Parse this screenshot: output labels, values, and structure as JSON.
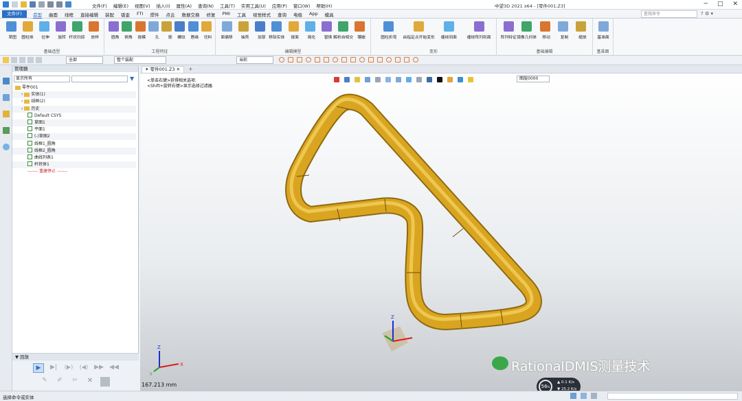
{
  "title_bar": {
    "menus": [
      "文件(F)",
      "编辑(E)",
      "视图(V)",
      "插入(I)",
      "属性(A)",
      "查询(N)",
      "工具(T)",
      "实用工具(U)",
      "应用(P)",
      "窗口(W)",
      "帮助(H)"
    ],
    "window_title": "中望3D 2021 x64 - [零件001.Z3]"
  },
  "tabs": {
    "file_label": "文件(F)",
    "items": [
      "造型",
      "曲面",
      "线框",
      "直接编辑",
      "装配",
      "钣金",
      "FTI",
      "焊件",
      "点云",
      "数据交换",
      "修复",
      "PMI",
      "工具",
      "视觉样式",
      "查询",
      "电极",
      "App",
      "模具"
    ],
    "active_index": 0,
    "search_placeholder": "查找命令"
  },
  "ribbon": {
    "groups": [
      {
        "label": "基础造型",
        "buttons": [
          "草图",
          "圆柱体",
          "拉伸",
          "旋转",
          "杆状扫掠",
          "放样"
        ]
      },
      {
        "label": "工程特征",
        "buttons": [
          "圆角",
          "倒角",
          "拔模",
          "孔",
          "筋",
          "螺纹",
          "唇缘",
          "坯料"
        ]
      },
      {
        "label": "编辑模型",
        "buttons": [
          "面偏移",
          "抽壳",
          "加厚",
          "移除实体",
          "拔面",
          "简化",
          "替换",
          "解析自相交",
          "镶嵌"
        ]
      },
      {
        "label": "变形",
        "buttons": [
          "圆柱折弯",
          "由指定点开始变形",
          "缠绕到面",
          "缠绕阵列到面"
        ]
      },
      {
        "label": "基础编辑",
        "buttons": [
          "阵列特征",
          "镜像几何体",
          "移动",
          "复制",
          "缩放"
        ]
      },
      {
        "label": "基准面",
        "buttons": [
          "基准面"
        ]
      }
    ]
  },
  "toolbar": {
    "filter_value": "全部",
    "scope_value": "整个装配",
    "orientation_value": "当前",
    "layer_value": "图层0000"
  },
  "manager": {
    "title": "管理器",
    "view_mode": "显示所有",
    "tree": [
      {
        "label": "零件001",
        "kind": "root",
        "indent": 0
      },
      {
        "label": "实体(1)",
        "kind": "folder",
        "indent": 1
      },
      {
        "label": "线框(2)",
        "kind": "folder",
        "indent": 1
      },
      {
        "label": "历史",
        "kind": "folder",
        "indent": 1
      },
      {
        "label": "Default CSYS",
        "kind": "item",
        "indent": 2
      },
      {
        "label": "草图1",
        "kind": "item",
        "indent": 2
      },
      {
        "label": "平面1",
        "kind": "item",
        "indent": 2
      },
      {
        "label": "(-)草图2",
        "kind": "item",
        "indent": 2
      },
      {
        "label": "线框1_圆角",
        "kind": "item",
        "indent": 2
      },
      {
        "label": "线框2_圆角",
        "kind": "item",
        "indent": 2
      },
      {
        "label": "曲线列表1",
        "kind": "item",
        "indent": 2
      },
      {
        "label": "杆状体1",
        "kind": "item",
        "indent": 2
      },
      {
        "label": "------- 重建停止 -------",
        "kind": "stop",
        "indent": 2
      }
    ],
    "regen_title": "回放"
  },
  "viewport": {
    "tab_label": "零件001.Z3",
    "hint_1": "<单击右键>获得相关选项.",
    "hint_2": "<Shift+旋转右键>显示选择过滤器.",
    "measure": "167.213 mm",
    "watermark": "RationalDMIS测量技术"
  },
  "status": {
    "message": "选择命令或实体",
    "perf_percent": "56",
    "perf_unit": "%",
    "net_up": "0.1",
    "net_down": "25.2",
    "net_unit": "K/s"
  },
  "colors": {
    "accent": "#2b6fc6",
    "model": "#d9a521",
    "model_dark": "#8f6a0e"
  }
}
